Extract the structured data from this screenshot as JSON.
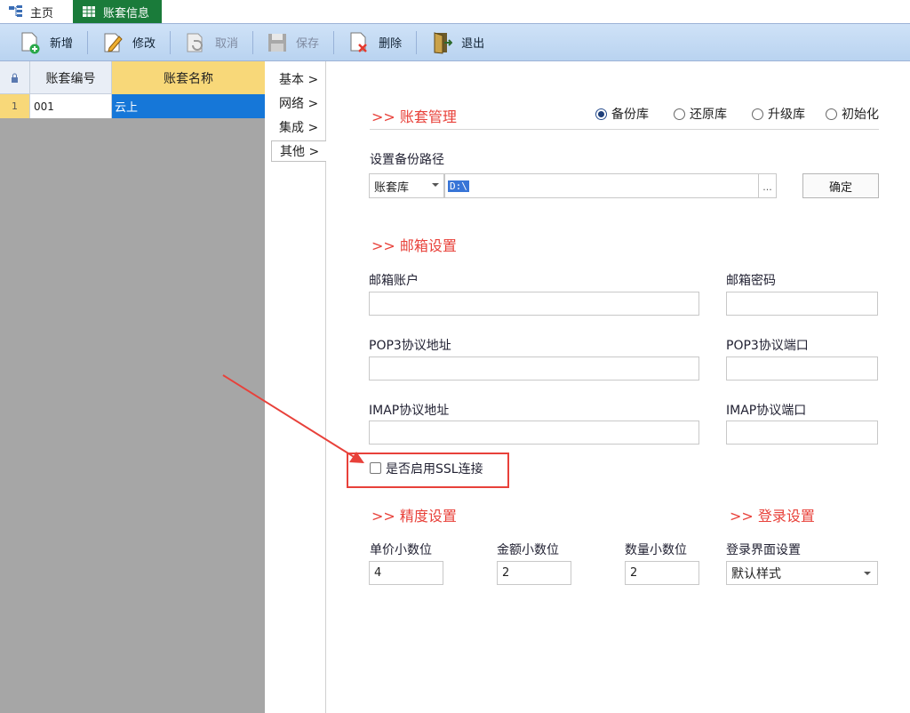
{
  "tabs": {
    "home": "主页",
    "current": "账套信息"
  },
  "toolbar": {
    "add": "新增",
    "edit": "修改",
    "cancel": "取消",
    "save": "保存",
    "delete": "删除",
    "exit": "退出"
  },
  "grid": {
    "headers": {
      "code": "账套编号",
      "name": "账套名称"
    },
    "rows": [
      {
        "index": "1",
        "code": "001",
        "name": "云上"
      }
    ]
  },
  "nav": {
    "items": [
      "基本 >",
      "网络 >",
      "集成 >",
      "其他 >"
    ],
    "active": "其他 >"
  },
  "backup": {
    "section_title": ">> 账套管理",
    "radios": [
      "备份库",
      "还原库",
      "升级库",
      "初始化"
    ],
    "selected": "备份库",
    "path_label": "设置备份路径",
    "db_select": "账套库",
    "path_value": "D:\\",
    "browse": "...",
    "confirm": "确定"
  },
  "mail": {
    "section_title": ">> 邮箱设置",
    "account_label": "邮箱账户",
    "password_label": "邮箱密码",
    "pop3_addr_label": "POP3协议地址",
    "pop3_port_label": "POP3协议端口",
    "imap_addr_label": "IMAP协议地址",
    "imap_port_label": "IMAP协议端口",
    "ssl_label": "是否启用SSL连接",
    "ssl_checked": false
  },
  "precision": {
    "section_title": ">> 精度设置",
    "unit_price_label": "单价小数位",
    "unit_price": "4",
    "amount_label": "金额小数位",
    "amount": "2",
    "qty_label": "数量小数位",
    "qty": "2"
  },
  "login": {
    "section_title": ">> 登录设置",
    "style_label": "登录界面设置",
    "style_value": "默认样式"
  },
  "colors": {
    "accent_red": "#e8413a",
    "tab_active": "#1a7b3a",
    "selection": "#1677d8"
  }
}
